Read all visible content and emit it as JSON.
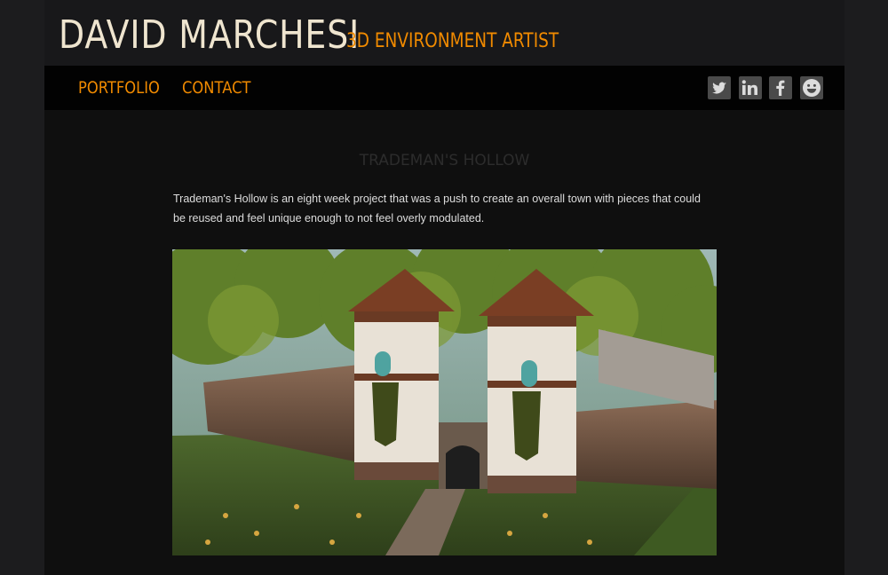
{
  "site": {
    "name": "DAVID MARCHESI",
    "tagline": "3D ENVIRONMENT ARTIST"
  },
  "nav": {
    "items": [
      "PORTFOLIO",
      "CONTACT"
    ]
  },
  "social": [
    "twitter-icon",
    "linkedin-icon",
    "facebook-icon",
    "smiley-icon"
  ],
  "post": {
    "title": "TRADEMAN'S HOLLOW",
    "body": "Trademan's Hollow is an eight week project that was a push to create an overall town with pieces that could be reused and feel unique enough to not feel overly modulated."
  },
  "colors": {
    "accent": "#f08a00",
    "title": "#efe5cf",
    "background": "#0f0f0f"
  }
}
